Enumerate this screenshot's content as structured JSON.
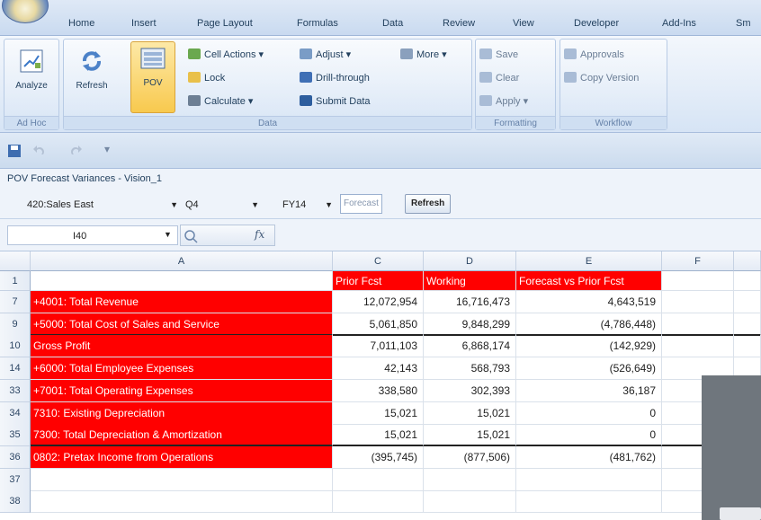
{
  "tabs": [
    "Home",
    "Insert",
    "Page Layout",
    "Formulas",
    "Data",
    "Review",
    "View",
    "Developer",
    "Add-Ins",
    "Sm"
  ],
  "ribbon": {
    "adhoc": {
      "label": "Ad Hoc",
      "analyze": "Analyze"
    },
    "data": {
      "label": "Data",
      "refresh": "Refresh",
      "pov": "POV",
      "cell_actions": "Cell Actions",
      "lock": "Lock",
      "calculate": "Calculate",
      "adjust": "Adjust",
      "drill_through": "Drill-through",
      "submit_data": "Submit Data",
      "more": "More"
    },
    "formatting": {
      "label": "Formatting",
      "save": "Save",
      "clear": "Clear",
      "apply": "Apply"
    },
    "workflow": {
      "label": "Workflow",
      "approvals": "Approvals",
      "copy_version": "Copy Version"
    }
  },
  "pov": {
    "title": "POV Forecast Variances - Vision_1",
    "entity": "420:Sales East",
    "period": "Q4",
    "year": "FY14",
    "scenario": "Forecast",
    "refresh": "Refresh"
  },
  "formula": {
    "namebox": "I40",
    "fx": "fx"
  },
  "grid": {
    "columns": [
      "A",
      "C",
      "D",
      "E",
      "F"
    ],
    "header_row": {
      "row": "1",
      "c": "Prior Fcst",
      "d": "Working",
      "e": "Forecast vs Prior Fcst"
    },
    "rows": [
      {
        "row": "7",
        "label": "+4001: Total Revenue",
        "c": "12,072,954",
        "d": "16,716,473",
        "e": "4,643,519"
      },
      {
        "row": "9",
        "label": "+5000: Total Cost of Sales and Service",
        "c": "5,061,850",
        "d": "9,848,299",
        "e": "(4,786,448)"
      },
      {
        "row": "10",
        "label": "Gross Profit",
        "c": "7,011,103",
        "d": "6,868,174",
        "e": "(142,929)"
      },
      {
        "row": "14",
        "label": "+6000: Total Employee Expenses",
        "c": "42,143",
        "d": "568,793",
        "e": "(526,649)"
      },
      {
        "row": "33",
        "label": "+7001: Total Operating Expenses",
        "c": "338,580",
        "d": "302,393",
        "e": "36,187"
      },
      {
        "row": "34",
        "label": "7310: Existing Depreciation",
        "c": "15,021",
        "d": "15,021",
        "e": "0"
      },
      {
        "row": "35",
        "label": "7300: Total Depreciation & Amortization",
        "c": "15,021",
        "d": "15,021",
        "e": "0"
      },
      {
        "row": "36",
        "label": "0802: Pretax Income from Operations",
        "c": "(395,745)",
        "d": "(877,506)",
        "e": "(481,762)"
      },
      {
        "row": "37",
        "label": "",
        "c": "",
        "d": "",
        "e": ""
      },
      {
        "row": "38",
        "label": "",
        "c": "",
        "d": "",
        "e": ""
      }
    ]
  },
  "colors": {
    "highlight_red": "#ff0000",
    "ribbon_blue": "#dbe6f4"
  }
}
